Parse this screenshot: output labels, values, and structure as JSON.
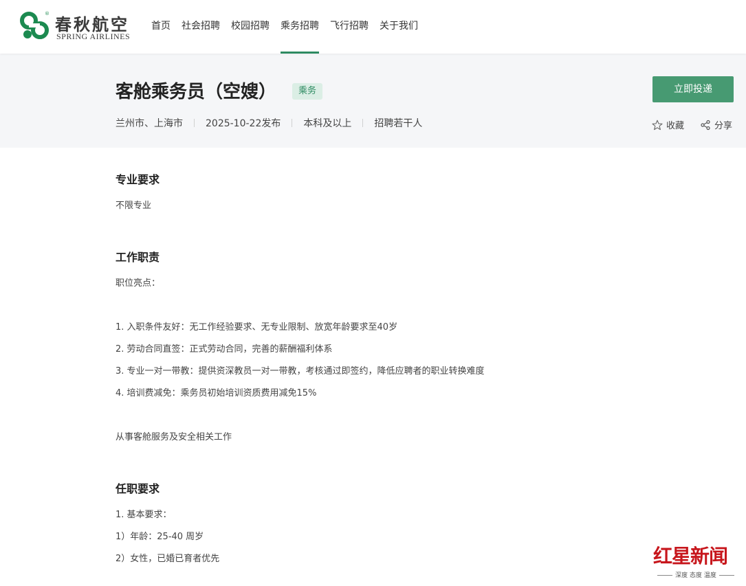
{
  "brand": {
    "name_cn": "春秋航空",
    "name_en": "SPRING AIRLINES",
    "registered": "®",
    "color": "#1c8a50"
  },
  "nav": {
    "items": [
      {
        "label": "首页",
        "active": false
      },
      {
        "label": "社会招聘",
        "active": false
      },
      {
        "label": "校园招聘",
        "active": false
      },
      {
        "label": "乘务招聘",
        "active": true
      },
      {
        "label": "飞行招聘",
        "active": false
      },
      {
        "label": "关于我们",
        "active": false
      }
    ],
    "active_color": "#2e8b62"
  },
  "job": {
    "title": "客舱乘务员（空嫂）",
    "tag": "乘务",
    "meta": [
      "兰州市、上海市",
      "2025-10-22发布",
      "本科及以上",
      "招聘若干人"
    ],
    "apply_label": "立即投递",
    "favorite_label": "收藏",
    "share_label": "分享",
    "favorite_icon": "star-outline-icon",
    "share_icon": "share-icon"
  },
  "sections": {
    "major": {
      "title": "专业要求",
      "lines": [
        "不限专业"
      ]
    },
    "duties": {
      "title": "工作职责",
      "lines": [
        "职位亮点：",
        "1. 入职条件友好：无工作经验要求、无专业限制、放宽年龄要求至40岁",
        "2. 劳动合同直签：正式劳动合同，完善的薪酬福利体系",
        "3. 专业一对一带教：提供资深教员一对一带教，考核通过即签约，降低应聘者的职业转换难度",
        "4. 培训费减免：乘务员初始培训资质费用减免15%",
        "从事客舱服务及安全相关工作"
      ]
    },
    "requirements": {
      "title": "任职要求",
      "lines": [
        "1. 基本要求：",
        "1）年龄：25-40 周岁",
        "2）女性，已婚已育者优先"
      ]
    }
  },
  "watermark": {
    "main": "红星新闻",
    "sub": "深度 态度 温度",
    "color": "#c7161c"
  }
}
